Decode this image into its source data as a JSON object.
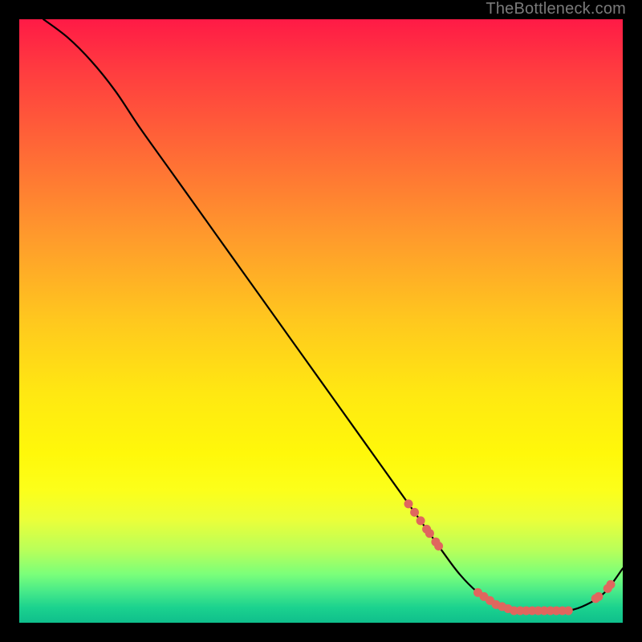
{
  "attribution": "TheBottleneck.com",
  "chart_data": {
    "type": "line",
    "title": "",
    "xlabel": "",
    "ylabel": "",
    "xlim": [
      0,
      100
    ],
    "ylim": [
      0,
      100
    ],
    "series": [
      {
        "name": "curve",
        "x": [
          4,
          8,
          12,
          16,
          20,
          25,
          30,
          35,
          40,
          45,
          50,
          55,
          60,
          65,
          70,
          73,
          76,
          79,
          82,
          85,
          88,
          91,
          94,
          97,
          100
        ],
        "y": [
          100,
          97,
          93,
          88,
          82,
          75,
          68,
          61,
          54,
          47,
          40,
          33,
          26,
          19,
          12,
          8,
          5,
          3,
          2,
          2,
          2,
          2,
          3,
          5,
          9
        ]
      }
    ],
    "markers": {
      "name": "points",
      "color": "#e0665e",
      "groups": [
        {
          "x": [
            64.5,
            65.5,
            66.5,
            67.5,
            68.0,
            69.0,
            69.5
          ],
          "y_approx": 13
        },
        {
          "x": [
            76,
            77,
            78,
            79,
            80,
            81,
            82,
            83,
            84,
            85,
            86,
            87,
            88,
            89,
            90,
            91
          ],
          "y_approx": 2
        },
        {
          "x": [
            95.5,
            96.0,
            97.5,
            98.0
          ],
          "y_approx": 5
        }
      ]
    }
  }
}
